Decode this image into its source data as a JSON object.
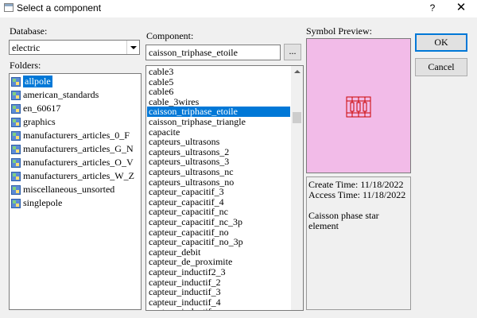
{
  "window": {
    "title": "Select a component",
    "help_label": "?",
    "close_label": "✕"
  },
  "database": {
    "label": "Database:",
    "value": "electric"
  },
  "folders": {
    "label": "Folders:",
    "items": [
      {
        "label": "allpole",
        "selected": true
      },
      {
        "label": "american_standards"
      },
      {
        "label": "en_60617"
      },
      {
        "label": "graphics"
      },
      {
        "label": "manufacturers_articles_0_F"
      },
      {
        "label": "manufacturers_articles_G_N"
      },
      {
        "label": "manufacturers_articles_O_V"
      },
      {
        "label": "manufacturers_articles_W_Z"
      },
      {
        "label": "miscellaneous_unsorted"
      },
      {
        "label": "singlepole"
      }
    ]
  },
  "component": {
    "label": "Component:",
    "value": "caisson_triphase_etoile",
    "browse_label": "...",
    "items": [
      {
        "label": "cable3"
      },
      {
        "label": "cable5"
      },
      {
        "label": "cable6"
      },
      {
        "label": "cable_3wires"
      },
      {
        "label": "caisson_triphase_etoile",
        "selected": true
      },
      {
        "label": "caisson_triphase_triangle"
      },
      {
        "label": "capacite"
      },
      {
        "label": "capteurs_ultrasons"
      },
      {
        "label": "capteurs_ultrasons_2"
      },
      {
        "label": "capteurs_ultrasons_3"
      },
      {
        "label": "capteurs_ultrasons_nc"
      },
      {
        "label": "capteurs_ultrasons_no"
      },
      {
        "label": "capteur_capacitif_3"
      },
      {
        "label": "capteur_capacitif_4"
      },
      {
        "label": "capteur_capacitif_nc"
      },
      {
        "label": "capteur_capacitif_nc_3p"
      },
      {
        "label": "capteur_capacitif_no"
      },
      {
        "label": "capteur_capacitif_no_3p"
      },
      {
        "label": "capteur_debit"
      },
      {
        "label": "capteur_de_proximite"
      },
      {
        "label": "capteur_inductif2_3"
      },
      {
        "label": "capteur_inductif_2"
      },
      {
        "label": "capteur_inductif_3"
      },
      {
        "label": "capteur_inductif_4"
      },
      {
        "label": "capteur_inductif_nc"
      }
    ]
  },
  "preview": {
    "label": "Symbol Preview:",
    "background": "#f2bbe8",
    "symbol_color": "#cc0000"
  },
  "info": {
    "create_time": "Create Time: 11/18/2022",
    "access_time": "Access Time: 11/18/2022",
    "description_line1": "Caisson phase star",
    "description_line2": "element"
  },
  "buttons": {
    "ok": "OK",
    "cancel": "Cancel"
  },
  "colors": {
    "selection": "#0078d7",
    "dialog_bg": "#f0f0f0"
  }
}
